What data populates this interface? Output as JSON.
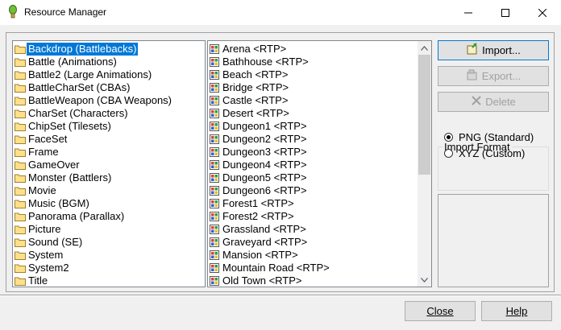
{
  "window": {
    "title": "Resource Manager",
    "minimize_icon": "minimize-icon",
    "maximize_icon": "maximize-icon",
    "close_icon": "close-icon"
  },
  "folders": [
    {
      "label": "Backdrop (Battlebacks)",
      "selected": true
    },
    {
      "label": "Battle (Animations)"
    },
    {
      "label": "Battle2 (Large Animations)"
    },
    {
      "label": "BattleCharSet (CBAs)"
    },
    {
      "label": "BattleWeapon (CBA Weapons)"
    },
    {
      "label": "CharSet (Characters)"
    },
    {
      "label": "ChipSet (Tilesets)"
    },
    {
      "label": "FaceSet"
    },
    {
      "label": "Frame"
    },
    {
      "label": "GameOver"
    },
    {
      "label": "Monster (Battlers)"
    },
    {
      "label": "Movie"
    },
    {
      "label": "Music (BGM)"
    },
    {
      "label": "Panorama (Parallax)"
    },
    {
      "label": "Picture"
    },
    {
      "label": "Sound (SE)"
    },
    {
      "label": "System"
    },
    {
      "label": "System2"
    },
    {
      "label": "Title"
    }
  ],
  "files": [
    {
      "label": "Arena <RTP>"
    },
    {
      "label": "Bathhouse <RTP>"
    },
    {
      "label": "Beach <RTP>"
    },
    {
      "label": "Bridge <RTP>"
    },
    {
      "label": "Castle <RTP>"
    },
    {
      "label": "Desert <RTP>"
    },
    {
      "label": "Dungeon1 <RTP>"
    },
    {
      "label": "Dungeon2 <RTP>"
    },
    {
      "label": "Dungeon3 <RTP>"
    },
    {
      "label": "Dungeon4 <RTP>"
    },
    {
      "label": "Dungeon5 <RTP>"
    },
    {
      "label": "Dungeon6 <RTP>"
    },
    {
      "label": "Forest1 <RTP>"
    },
    {
      "label": "Forest2 <RTP>"
    },
    {
      "label": "Grassland <RTP>"
    },
    {
      "label": "Graveyard <RTP>"
    },
    {
      "label": "Mansion <RTP>"
    },
    {
      "label": "Mountain Road <RTP>"
    },
    {
      "label": "Old Town <RTP>"
    }
  ],
  "actions": {
    "import_label": "Import...",
    "export_label": "Export...",
    "delete_label": "Delete"
  },
  "import_format": {
    "title": "Import Format",
    "options": [
      {
        "label": "PNG (Standard)",
        "checked": true
      },
      {
        "label": "XYZ (Custom)",
        "checked": false
      }
    ]
  },
  "footer": {
    "close_label": "Close",
    "help_label": "Help"
  },
  "colors": {
    "selection": "#0078d7",
    "folder": "#ffe08a",
    "disabled_text": "#a0a0a0"
  }
}
